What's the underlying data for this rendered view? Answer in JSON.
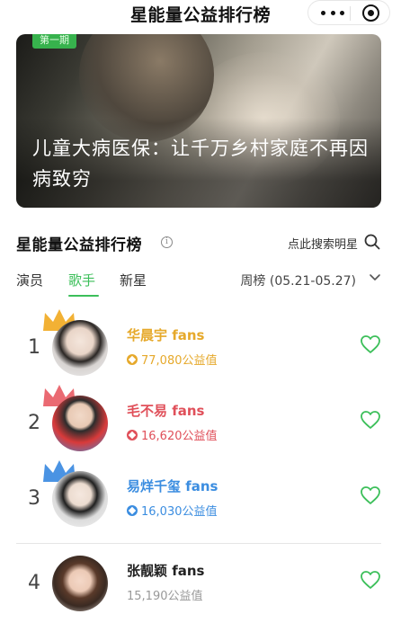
{
  "header": {
    "title": "星能量公益排行榜"
  },
  "banner": {
    "tag": "第一期",
    "headline": "儿童大病医保：让千万乡村家庭不再因病致穷"
  },
  "section": {
    "title": "星能量公益排行榜",
    "search_label": "点此搜索明星"
  },
  "tabs": [
    {
      "label": "演员",
      "active": false
    },
    {
      "label": "歌手",
      "active": true
    },
    {
      "label": "新星",
      "active": false
    }
  ],
  "period": "周榜 (05.21-05.27)",
  "ranking": [
    {
      "rank": "1",
      "name": "华晨宇 fans",
      "points": "77,080公益值",
      "color": "#e6a92b"
    },
    {
      "rank": "2",
      "name": "毛不易 fans",
      "points": "16,620公益值",
      "color": "#e0505a"
    },
    {
      "rank": "3",
      "name": "易烊千玺 fans",
      "points": "16,030公益值",
      "color": "#3b8de0"
    },
    {
      "rank": "4",
      "name": "张靓颖 fans",
      "points": "15,190公益值",
      "color": "#222222"
    }
  ],
  "colors": {
    "accent_green": "#3cbf5a",
    "gold": "#e6a92b",
    "red": "#e0505a",
    "blue": "#3b8de0"
  },
  "icons": {
    "more": "more-dots-icon",
    "close": "close-circle-icon",
    "info": "info-icon",
    "search": "search-icon",
    "chevron": "chevron-down-icon",
    "heart": "heart-outline-icon",
    "crown": "crown-icon"
  }
}
